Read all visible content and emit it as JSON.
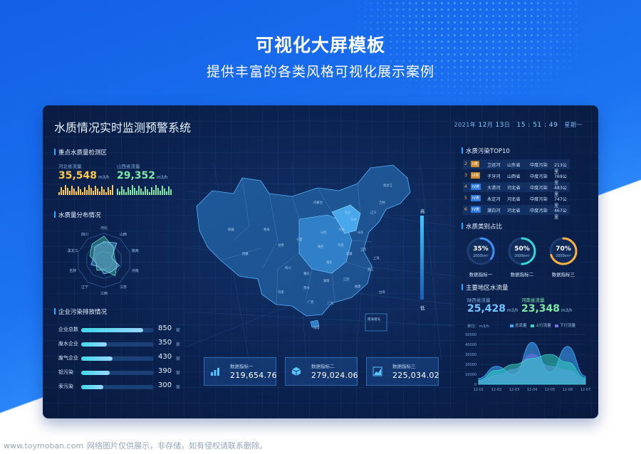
{
  "hero": {
    "title": "可视化大屏模板",
    "subtitle": "提供丰富的各类风格可视化展示案例"
  },
  "dashboard": {
    "title": "水质情况实时监测预警系统",
    "date": {
      "year": "2021",
      "y_sep": "年",
      "month": "12",
      "m_sep": "月",
      "day": "13",
      "d_sep": "日",
      "time": "15 : 51 : 49",
      "weekday": "星期一"
    }
  },
  "left": {
    "monitor": {
      "title": "重点水质量检测区",
      "items": [
        {
          "label": "河北省流量",
          "value": "35,548",
          "unit": "m3/h"
        },
        {
          "label": "山西省流量",
          "value": "29,352",
          "unit": "m3/h"
        }
      ]
    },
    "distribution": {
      "title": "水质量分布情况",
      "axes": [
        "河北",
        "山西",
        "陕西",
        "河南",
        "江苏",
        "江西",
        "辽宁",
        "吉林",
        "黑龙江",
        "四川"
      ]
    },
    "pollution": {
      "title": "企业污染排放情况",
      "rows": [
        {
          "label": "企业总数",
          "value": "850",
          "unit": "家",
          "fraction": 0.85
        },
        {
          "label": "废水企业",
          "value": "350",
          "unit": "家",
          "fraction": 0.35
        },
        {
          "label": "废气企业",
          "value": "430",
          "unit": "家",
          "fraction": 0.43
        },
        {
          "label": "铅污染",
          "value": "390",
          "unit": "家",
          "fraction": 0.39
        },
        {
          "label": "汞污染",
          "value": "300",
          "unit": "家",
          "fraction": 0.3
        }
      ]
    }
  },
  "center": {
    "scale": {
      "high": "高",
      "low": "低"
    },
    "inset_label": "南海诸岛",
    "map_labels": [
      "新疆",
      "西藏",
      "青海",
      "甘肃",
      "内蒙古",
      "黑龙江",
      "吉林",
      "辽宁",
      "北京",
      "天津",
      "河北",
      "山西",
      "宁夏",
      "陕西",
      "河南",
      "山东",
      "江苏",
      "安徽",
      "湖北",
      "四川",
      "重庆",
      "湖南",
      "江西",
      "贵州",
      "云南",
      "广西",
      "广东",
      "福建",
      "浙江",
      "上海",
      "海南",
      "台湾"
    ],
    "kpis": [
      {
        "label": "数据指标一",
        "value": "219,654.76",
        "icon": "chart-icon"
      },
      {
        "label": "数据指标二",
        "value": "279,024.06",
        "icon": "cube-icon"
      },
      {
        "label": "数据指标三",
        "value": "225,034.02",
        "icon": "area-chart-icon"
      }
    ]
  },
  "right": {
    "top10": {
      "title": "水质污染TOP10",
      "rows": [
        {
          "rank": "2",
          "level": "II类",
          "river": "卫运河",
          "province": "山东省",
          "degree": "中度污染",
          "length": "213公里"
        },
        {
          "rank": "3",
          "level": "III类",
          "river": "子牙河",
          "province": "山西省",
          "degree": "中度污染",
          "length": "769公里"
        },
        {
          "rank": "4",
          "level": "IV类",
          "river": "大清河",
          "province": "河北省",
          "degree": "中度污染",
          "length": "483公里"
        },
        {
          "rank": "5",
          "level": "IV类",
          "river": "永定河",
          "province": "河北省",
          "degree": "中度污染",
          "length": "747公里"
        },
        {
          "rank": "6",
          "level": "IV类",
          "river": "潮白河",
          "province": "河北省",
          "degree": "中度污染",
          "length": "467公里"
        }
      ]
    },
    "ratio": {
      "title": "水质类别占比",
      "items": [
        {
          "percent": "35%",
          "value": "2000km²",
          "label": "数据指标一",
          "fraction": 0.35,
          "color": "#3f8fff"
        },
        {
          "percent": "50%",
          "value": "2000km²",
          "label": "数据指标二",
          "fraction": 0.5,
          "color": "#34d8d0"
        },
        {
          "percent": "70%",
          "value": "2000km²",
          "label": "数据指标三",
          "fraction": 0.7,
          "color": "#ffb13f"
        }
      ]
    },
    "flow": {
      "title": "主要地区水流量",
      "items": [
        {
          "label": "陕西省流量",
          "value": "25,428",
          "unit": "m3/h"
        },
        {
          "label": "河南省流量",
          "value": "23,348",
          "unit": "m3/h"
        }
      ],
      "unit_label": "单位：m3/h",
      "legend": [
        "总流量",
        "上行流量",
        "下行流量"
      ],
      "legend_colors": [
        "#3fa7ff",
        "#35d3c6",
        "#7a6cf0"
      ]
    }
  },
  "chart_data": {
    "type": "area",
    "x": [
      "12-01",
      "12-02",
      "12-03",
      "12-04",
      "12-05",
      "12-06",
      "12-07"
    ],
    "ylim": [
      0,
      50000
    ],
    "yticks": [
      "50000",
      "40000",
      "30000",
      "20000",
      "10000",
      "0"
    ],
    "series": [
      {
        "name": "总流量",
        "values": [
          6000,
          18000,
          10000,
          42000,
          12000,
          38000,
          8000
        ]
      },
      {
        "name": "上行流量",
        "values": [
          4000,
          14000,
          20000,
          26000,
          30000,
          22000,
          6000
        ]
      },
      {
        "name": "下行流量",
        "values": [
          3000,
          9000,
          15000,
          30000,
          18000,
          14000,
          4000
        ]
      }
    ]
  },
  "footer": {
    "site": "www.toymoban.com",
    "notice": "网络图片仅供展示，非存储，如有侵权请联系删除。"
  }
}
